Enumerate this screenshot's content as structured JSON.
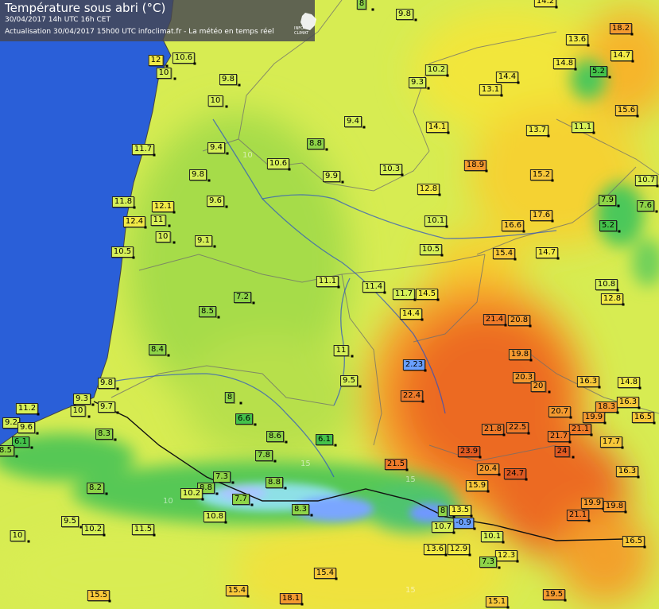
{
  "header": {
    "title": "Température sous abri (°C)",
    "date_line": "30/04/2017  14h UTC  16h CET",
    "update_line": "Actualisation 30/04/2017 15h00 UTC  infoclimat.fr - La météo en temps réel",
    "logo_text": "INFO CLIMAT"
  },
  "isotherm_labels": [
    "10",
    "15",
    "10",
    "15",
    "15"
  ],
  "temperatures": [
    {
      "v": "8"
    },
    {
      "v": "9.8"
    },
    {
      "v": "14.2"
    },
    {
      "v": "18.2"
    },
    {
      "v": "13.6"
    },
    {
      "v": "14.7"
    },
    {
      "v": "12"
    },
    {
      "v": "10.6"
    },
    {
      "v": "10"
    },
    {
      "v": "10.2"
    },
    {
      "v": "14.8"
    },
    {
      "v": "5.2"
    },
    {
      "v": "9.8"
    },
    {
      "v": "9.3"
    },
    {
      "v": "14.4"
    },
    {
      "v": "13.1"
    },
    {
      "v": "10"
    },
    {
      "v": "15.6"
    },
    {
      "v": "9.4"
    },
    {
      "v": "14.1"
    },
    {
      "v": "13.7"
    },
    {
      "v": "11.1"
    },
    {
      "v": "11.7"
    },
    {
      "v": "9.4"
    },
    {
      "v": "8.8"
    },
    {
      "v": "10.6"
    },
    {
      "v": "18.9"
    },
    {
      "v": "9.9"
    },
    {
      "v": "10.3"
    },
    {
      "v": "15.2"
    },
    {
      "v": "10.7"
    },
    {
      "v": "9.8"
    },
    {
      "v": "12.8"
    },
    {
      "v": "7.9"
    },
    {
      "v": "7.6"
    },
    {
      "v": "11.8"
    },
    {
      "v": "9.6"
    },
    {
      "v": "12.1"
    },
    {
      "v": "12.4"
    },
    {
      "v": "11"
    },
    {
      "v": "17.6"
    },
    {
      "v": "10.1"
    },
    {
      "v": "16.6"
    },
    {
      "v": "5.2"
    },
    {
      "v": "10"
    },
    {
      "v": "9.1"
    },
    {
      "v": "10.5"
    },
    {
      "v": "10.5"
    },
    {
      "v": "15.4"
    },
    {
      "v": "14.7"
    },
    {
      "v": "11.1"
    },
    {
      "v": "11.4"
    },
    {
      "v": "10.8"
    },
    {
      "v": "11.7"
    },
    {
      "v": "14.5"
    },
    {
      "v": "12.8"
    },
    {
      "v": "7.2"
    },
    {
      "v": "8.5"
    },
    {
      "v": "14.4"
    },
    {
      "v": "21.4"
    },
    {
      "v": "20.8"
    },
    {
      "v": "8.4"
    },
    {
      "v": "11"
    },
    {
      "v": "19.8"
    },
    {
      "v": "2.23"
    },
    {
      "v": "20.3"
    },
    {
      "v": "9.8"
    },
    {
      "v": "9.5"
    },
    {
      "v": "16.3"
    },
    {
      "v": "14.8"
    },
    {
      "v": "9.3"
    },
    {
      "v": "22.4"
    },
    {
      "v": "20"
    },
    {
      "v": "11.2"
    },
    {
      "v": "9.7"
    },
    {
      "v": "10"
    },
    {
      "v": "8"
    },
    {
      "v": "18.3"
    },
    {
      "v": "16.3"
    },
    {
      "v": "20.7"
    },
    {
      "v": "9.2"
    },
    {
      "v": "6.6"
    },
    {
      "v": "19.9"
    },
    {
      "v": "16.5"
    },
    {
      "v": "9.6"
    },
    {
      "v": "8.3"
    },
    {
      "v": "21.8"
    },
    {
      "v": "22.5"
    },
    {
      "v": "21.1"
    },
    {
      "v": "6.1"
    },
    {
      "v": "8.6"
    },
    {
      "v": "6.1"
    },
    {
      "v": "21.7"
    },
    {
      "v": "17.7"
    },
    {
      "v": "8.5"
    },
    {
      "v": "7.8"
    },
    {
      "v": "23.9"
    },
    {
      "v": "24"
    },
    {
      "v": "21.5"
    },
    {
      "v": "20.4"
    },
    {
      "v": "24.7"
    },
    {
      "v": "16.3"
    },
    {
      "v": "7.3"
    },
    {
      "v": "8.8"
    },
    {
      "v": "8.2"
    },
    {
      "v": "8.8"
    },
    {
      "v": "15.9"
    },
    {
      "v": "10.2"
    },
    {
      "v": "7.7"
    },
    {
      "v": "8.3"
    },
    {
      "v": "8"
    },
    {
      "v": "13.5"
    },
    {
      "v": "19.9"
    },
    {
      "v": "19.8"
    },
    {
      "v": "10.8"
    },
    {
      "v": "21.1"
    },
    {
      "v": "9.5"
    },
    {
      "v": "-0.9"
    },
    {
      "v": "10.7"
    },
    {
      "v": "10.2"
    },
    {
      "v": "11.5"
    },
    {
      "v": "10.1"
    },
    {
      "v": "10"
    },
    {
      "v": "13.6"
    },
    {
      "v": "12.9"
    },
    {
      "v": "12.3"
    },
    {
      "v": "16.5"
    },
    {
      "v": "7.3"
    },
    {
      "v": "15.4"
    },
    {
      "v": "15.5"
    },
    {
      "v": "15.4"
    },
    {
      "v": "18.1"
    },
    {
      "v": "15.1"
    },
    {
      "v": "19.5"
    }
  ]
}
